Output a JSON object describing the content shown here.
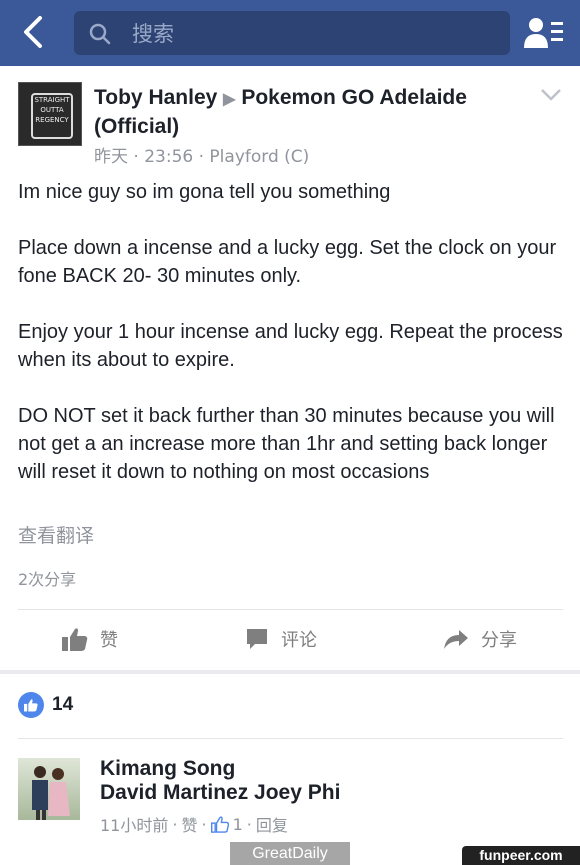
{
  "search": {
    "placeholder": "搜索"
  },
  "post": {
    "author": "Toby Hanley",
    "group": "Pokemon GO Adelaide (Official)",
    "avatar_text": "STRAIGHT OUTTA REGENCY",
    "time": "昨天 · 23:56",
    "location": "Playford (C)",
    "paragraphs": [
      "Im nice guy so im gona tell you something",
      "Place down a incense and a lucky egg. Set the clock on your fone BACK 20- 30 minutes only.",
      "Enjoy your 1 hour incense and lucky egg. Repeat the process when its about to expire.",
      "DO NOT set it back further than 30 minutes because you will not get a an increase more than 1hr and setting back longer will reset it down to nothing on most occasions"
    ],
    "translate": "查看翻译",
    "shares": "2次分享"
  },
  "actions": {
    "like": "赞",
    "comment": "评论",
    "share": "分享"
  },
  "reactions": {
    "count": "14"
  },
  "comment": {
    "name": "Kimang Song",
    "tags": "David Martinez Joey Phi",
    "time": "11小时前",
    "like": "赞",
    "like_count": "1",
    "reply": "回复"
  },
  "watermarks": {
    "left": "GreatDaily",
    "right": "funpeer.com"
  },
  "colors": {
    "header": "#3b5998",
    "search": "#2d4373",
    "like_badge": "#4e86ec",
    "meta": "#90949c"
  }
}
